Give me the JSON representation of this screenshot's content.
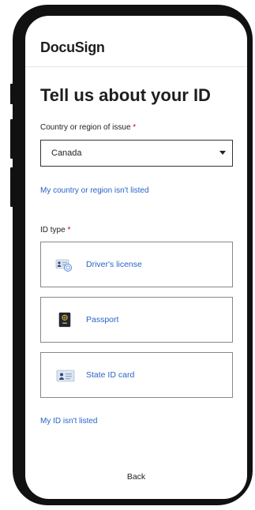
{
  "app": {
    "logo": "DocuSign"
  },
  "page": {
    "title": "Tell us about your ID"
  },
  "country": {
    "label": "Country or region of issue",
    "required_mark": "*",
    "selected_value": "Canada",
    "not_listed_link": "My country or region isn't listed"
  },
  "id_type": {
    "label": "ID type",
    "required_mark": "*",
    "options": [
      {
        "label": "Driver's license",
        "icon": "drivers-license-icon"
      },
      {
        "label": "Passport",
        "icon": "passport-icon"
      },
      {
        "label": "State ID card",
        "icon": "state-id-card-icon"
      }
    ],
    "not_listed_link": "My ID isn't listed"
  },
  "footer": {
    "back_label": "Back"
  },
  "colors": {
    "link": "#2a62c9",
    "required": "#d0021b",
    "frame": "#111111"
  }
}
